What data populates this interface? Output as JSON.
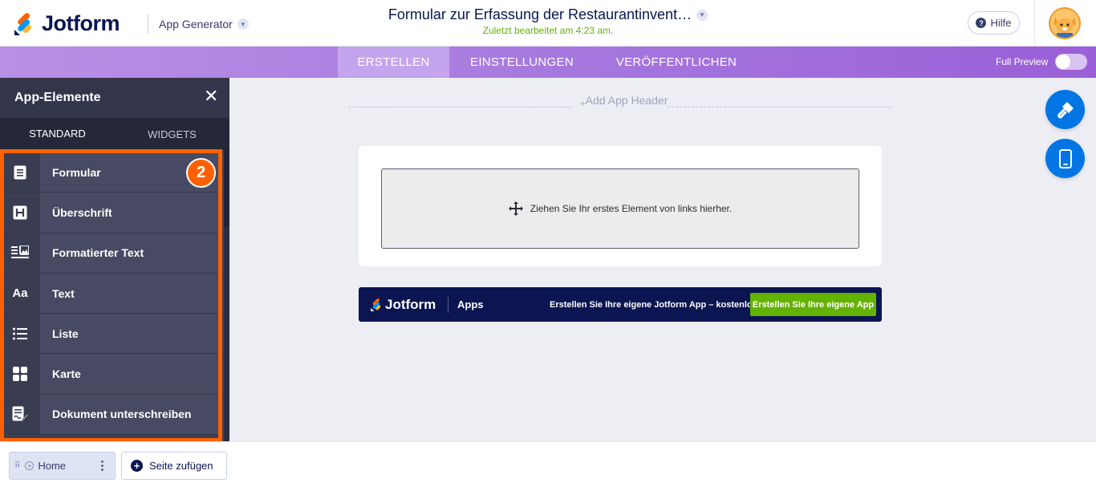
{
  "header": {
    "brand": "Jotform",
    "product": "App Generator",
    "title": "Formular zur Erfassung der Restaurantinvent…",
    "last_edited": "Zuletzt bearbeitet am 4:23 am.",
    "help_label": "Hilfe"
  },
  "nav": {
    "tabs": [
      {
        "label": "ERSTELLEN",
        "active": true
      },
      {
        "label": "EINSTELLUNGEN",
        "active": false
      },
      {
        "label": "VERÖFFENTLICHEN",
        "active": false
      }
    ],
    "full_preview_label": "Full Preview",
    "full_preview_on": false
  },
  "sidebar": {
    "title": "App-Elemente",
    "tabs": [
      {
        "label": "STANDARD",
        "active": true
      },
      {
        "label": "WIDGETS",
        "active": false
      }
    ],
    "items": [
      {
        "label": "Formular",
        "icon": "form-icon"
      },
      {
        "label": "Überschrift",
        "icon": "heading-icon"
      },
      {
        "label": "Formatierter Text",
        "icon": "formatted-text-icon"
      },
      {
        "label": "Text",
        "icon": "text-icon"
      },
      {
        "label": "Liste",
        "icon": "list-icon"
      },
      {
        "label": "Karte",
        "icon": "card-icon"
      },
      {
        "label": "Dokument unterschreiben",
        "icon": "sign-document-icon"
      }
    ],
    "step_badge": "2"
  },
  "canvas": {
    "add_header": "Add App Header",
    "dropzone_text": "Ziehen Sie Ihr erstes Element von links hierher.",
    "promo": {
      "brand": "Jotform",
      "section": "Apps",
      "text": "Erstellen Sie Ihre eigene Jotform App – kostenlos",
      "button": "Erstellen Sie Ihre eigene App"
    }
  },
  "footer": {
    "page_name": "Home",
    "add_page_label": "Seite zufügen"
  },
  "colors": {
    "accent_blue": "#0075e3",
    "highlight_orange": "#ff6100",
    "success_green": "#64b200",
    "navy": "#0a1551",
    "nav_purple": "#a97ee0"
  }
}
